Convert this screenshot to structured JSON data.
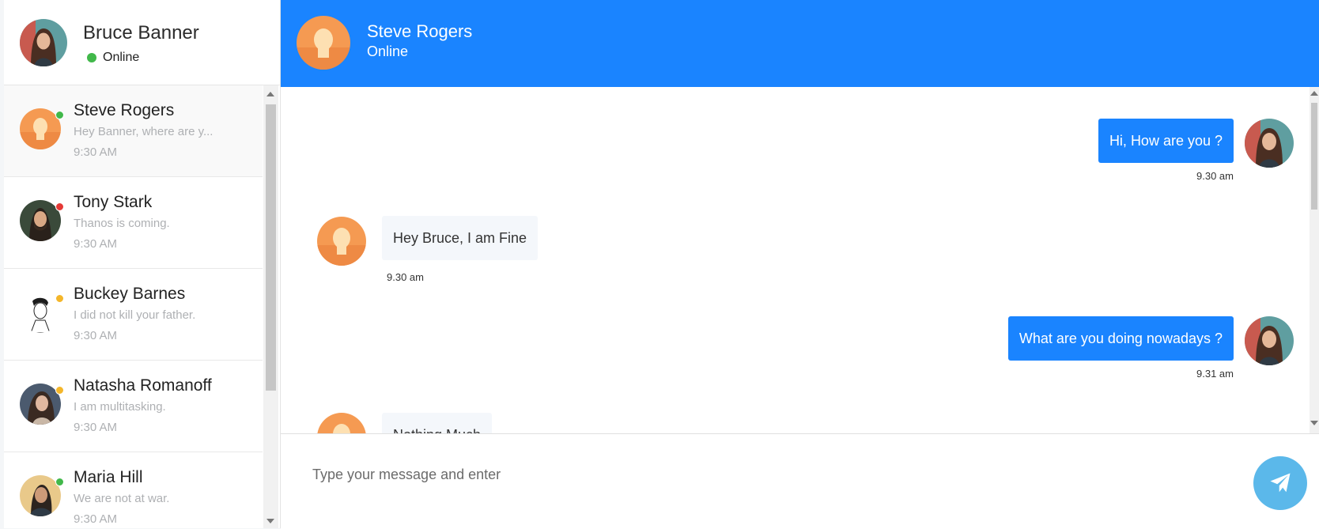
{
  "current_user": {
    "name": "Bruce Banner",
    "status": "Online"
  },
  "contacts": [
    {
      "name": "Steve Rogers",
      "last": "Hey Banner, where are y...",
      "time": "9:30 AM",
      "presence": "#41b84a"
    },
    {
      "name": "Tony Stark",
      "last": "Thanos is coming.",
      "time": "9:30 AM",
      "presence": "#e53935"
    },
    {
      "name": "Buckey Barnes",
      "last": "I did not kill your father.",
      "time": "9:30 AM",
      "presence": "#f4b62a"
    },
    {
      "name": "Natasha Romanoff",
      "last": "I am multitasking.",
      "time": "9:30 AM",
      "presence": "#f4b62a"
    },
    {
      "name": "Maria Hill",
      "last": "We are not at war.",
      "time": "9:30 AM",
      "presence": "#41b84a"
    }
  ],
  "chat": {
    "contact_name": "Steve Rogers",
    "contact_status": "Online",
    "messages": [
      {
        "text": "Hi, How are you ?",
        "time": "9.30 am",
        "direction": "out"
      },
      {
        "text": "Hey Bruce, I am Fine",
        "time": "9.30 am",
        "direction": "in"
      },
      {
        "text": "What are you doing nowadays ?",
        "time": "9.31 am",
        "direction": "out"
      },
      {
        "text": "Nothing Much",
        "time": "",
        "direction": "in"
      }
    ]
  },
  "composer": {
    "placeholder": "Type your message and enter"
  },
  "colors": {
    "primary": "#1a84ff",
    "send": "#5bb8ea",
    "online": "#41b84a",
    "busy": "#e53935",
    "away": "#f4b62a"
  }
}
